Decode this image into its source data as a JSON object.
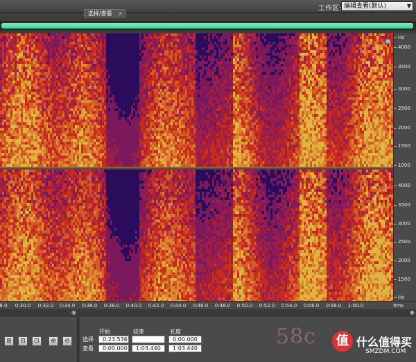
{
  "header": {
    "workspace_label": "工作区:",
    "workspace_value": "编辑查看(默认)"
  },
  "colors": {
    "spectral_bg": "#2a0b5c",
    "heat_mid": "#e33314",
    "heat_high": "#ffd23a",
    "overview_bar": "#5fe3b1"
  },
  "hz_scale": {
    "unit": "Hz",
    "ticks": [
      "4000",
      "3500",
      "3000",
      "2500",
      "2000",
      "1500",
      "1000"
    ],
    "ticks_lower": [
      "4000",
      "3500",
      "3000",
      "2500",
      "2000",
      "1500"
    ]
  },
  "timeline": {
    "unit": "hms",
    "ticks": [
      "8.0",
      "0:30.0",
      "0:32.0",
      "0:34.0",
      "0:36.0",
      "0:38.0",
      "0:40.0",
      "0:42.0",
      "0:44.0",
      "0:46.0",
      "0:48.0",
      "0:50.0",
      "0:52.0",
      "0:54.0",
      "0:56.0",
      "0:58.0",
      "1:00.0"
    ]
  },
  "selection_panel": {
    "tab_label": "选择/查看",
    "col_start": "开始",
    "col_end": "结束",
    "col_length": "长度",
    "row_selection": "选择",
    "row_view": "查看",
    "selection_start": "0:23.536",
    "selection_end": "",
    "selection_length": "0:00.000",
    "view_start": "0:00.000",
    "view_end": "1:03.440",
    "view_length": "1:03.440"
  },
  "zoom_buttons": [
    {
      "name": "zoom-in-amplitude-icon",
      "glyph": "⊞"
    },
    {
      "name": "zoom-out-amplitude-icon",
      "glyph": "⊟"
    },
    {
      "name": "zoom-full-icon",
      "glyph": "⊡"
    },
    {
      "name": "zoom-in-left-icon",
      "glyph": "⊕"
    },
    {
      "name": "zoom-out-right-icon",
      "glyph": "⊖"
    }
  ],
  "watermark": {
    "left": "58c",
    "logo": "值",
    "brand": "什么值得买",
    "site": "SMZDM.COM"
  }
}
